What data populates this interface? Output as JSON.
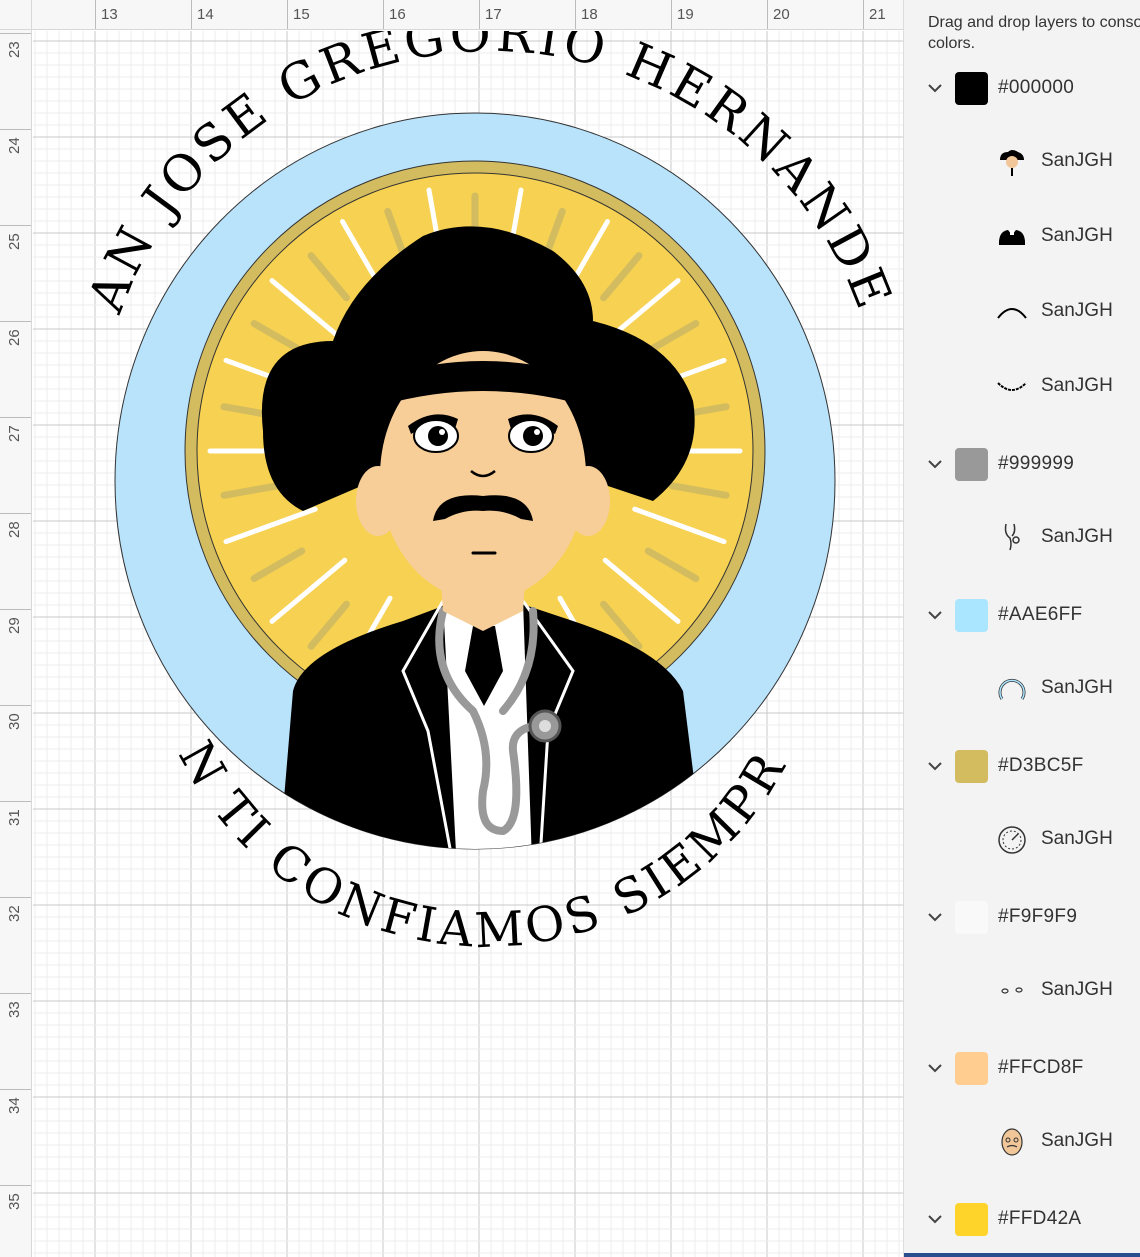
{
  "ruler": {
    "top": [
      "13",
      "14",
      "15",
      "16",
      "17",
      "18",
      "19",
      "20",
      "21"
    ],
    "left": [
      "23",
      "24",
      "25",
      "26",
      "27",
      "28",
      "29",
      "30",
      "31",
      "32",
      "33",
      "34",
      "35"
    ]
  },
  "artwork": {
    "top_text": "SAN JOSE GREGORIO HERNANDEZ",
    "bottom_text": "EN TI CONFIAMOS SIEMPRE"
  },
  "panel": {
    "hint": "Drag and drop layers to consolidate colors.",
    "groups": [
      {
        "hex": "#000000",
        "color": "#000000",
        "layers": [
          {
            "name": "SanJGH",
            "icon": "hat-face-icon"
          },
          {
            "name": "SanJGH",
            "icon": "jacket-icon"
          },
          {
            "name": "SanJGH",
            "icon": "arc-top-icon"
          },
          {
            "name": "SanJGH",
            "icon": "arc-bottom-icon"
          }
        ]
      },
      {
        "hex": "#999999",
        "color": "#999999",
        "layers": [
          {
            "name": "SanJGH",
            "icon": "stethoscope-icon"
          }
        ]
      },
      {
        "hex": "#AAE6FF",
        "color": "#AAE6FF",
        "layers": [
          {
            "name": "SanJGH",
            "icon": "ring-icon"
          }
        ]
      },
      {
        "hex": "#D3BC5F",
        "color": "#D3BC5F",
        "layers": [
          {
            "name": "SanJGH",
            "icon": "sun-rays-icon"
          }
        ]
      },
      {
        "hex": "#F9F9F9",
        "color": "#F9F9F9",
        "layers": [
          {
            "name": "SanJGH",
            "icon": "eyes-icon"
          }
        ]
      },
      {
        "hex": "#FFCD8F",
        "color": "#FFCD8F",
        "layers": [
          {
            "name": "SanJGH",
            "icon": "face-icon"
          }
        ]
      },
      {
        "hex": "#FFD42A",
        "color": "#FFD42A",
        "layers": []
      }
    ]
  }
}
